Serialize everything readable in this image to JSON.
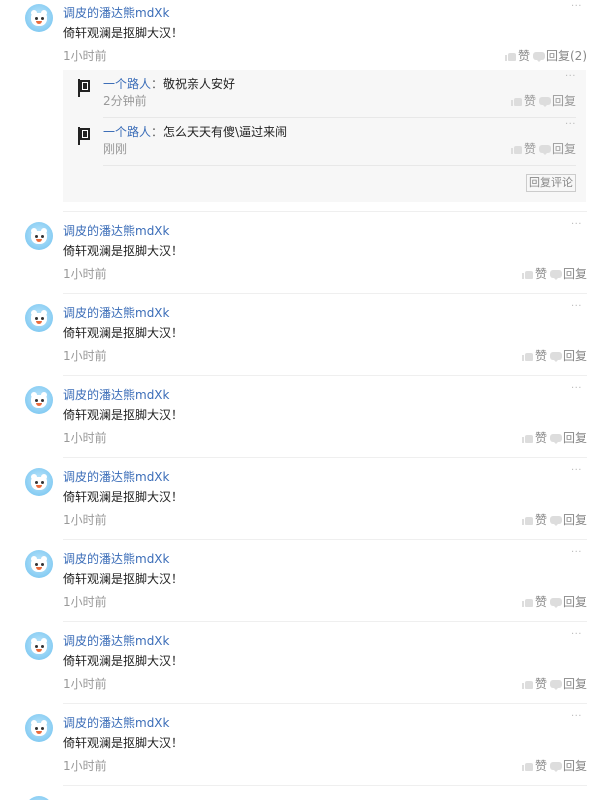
{
  "comments": [
    {
      "user": "调皮的潘达熊mdXk",
      "text": "倚轩观澜是抠脚大汉！",
      "time": "1小时前",
      "like_label": "赞",
      "reply_label": "回复(2)",
      "more": "···",
      "replies": [
        {
          "user": "一个路人",
          "sep": "：",
          "text": "敬祝亲人安好",
          "time": "2分钟前",
          "like_label": "赞",
          "reply_label": "回复",
          "more": "···"
        },
        {
          "user": "一个路人",
          "sep": "：",
          "text": "怎么天天有傻\\逼过来闹",
          "time": "刚刚",
          "like_label": "赞",
          "reply_label": "回复",
          "more": "···"
        }
      ],
      "reply_comment_label": "回复评论"
    },
    {
      "user": "调皮的潘达熊mdXk",
      "text": "倚轩观澜是抠脚大汉！",
      "time": "1小时前",
      "like_label": "赞",
      "reply_label": "回复",
      "more": "···"
    },
    {
      "user": "调皮的潘达熊mdXk",
      "text": "倚轩观澜是抠脚大汉！",
      "time": "1小时前",
      "like_label": "赞",
      "reply_label": "回复",
      "more": "···"
    },
    {
      "user": "调皮的潘达熊mdXk",
      "text": "倚轩观澜是抠脚大汉！",
      "time": "1小时前",
      "like_label": "赞",
      "reply_label": "回复",
      "more": "···"
    },
    {
      "user": "调皮的潘达熊mdXk",
      "text": "倚轩观澜是抠脚大汉！",
      "time": "1小时前",
      "like_label": "赞",
      "reply_label": "回复",
      "more": "···"
    },
    {
      "user": "调皮的潘达熊mdXk",
      "text": "倚轩观澜是抠脚大汉！",
      "time": "1小时前",
      "like_label": "赞",
      "reply_label": "回复",
      "more": "···"
    },
    {
      "user": "调皮的潘达熊mdXk",
      "text": "倚轩观澜是抠脚大汉！",
      "time": "1小时前",
      "like_label": "赞",
      "reply_label": "回复",
      "more": "···"
    },
    {
      "user": "调皮的潘达熊mdXk",
      "text": "倚轩观澜是抠脚大汉！",
      "time": "1小时前",
      "like_label": "赞",
      "reply_label": "回复",
      "more": "···"
    }
  ],
  "colors": {
    "username": "#3b6db8",
    "muted": "#999999",
    "reply_bg": "#f7f7f7",
    "avatar": "#8fd0f4"
  },
  "icons": {
    "like": "thumbs-up-icon",
    "reply": "speech-bubble-icon",
    "more": "more-dots-icon",
    "avatar": "panda-bear-avatar",
    "reply_avatar": "flag-avatar"
  }
}
